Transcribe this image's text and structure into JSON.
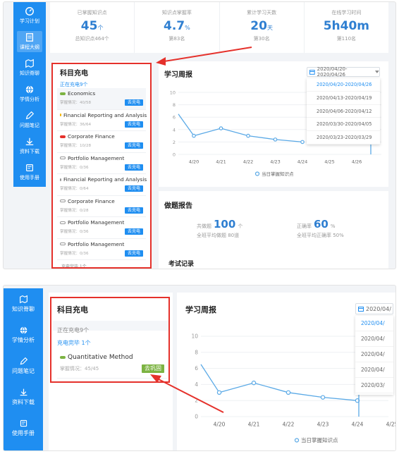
{
  "sidebar_top": {
    "items": [
      {
        "label": "学习计划",
        "icon": "gauge-icon"
      },
      {
        "label": "课程大纲",
        "icon": "book-icon",
        "active": true
      },
      {
        "label": "知识脊聊",
        "icon": "map-icon"
      },
      {
        "label": "学情分析",
        "icon": "globe-icon"
      },
      {
        "label": "问题笔记",
        "icon": "pencil-icon"
      },
      {
        "label": "资料下载",
        "icon": "download-icon"
      },
      {
        "label": "使用手册",
        "icon": "manual-icon"
      }
    ]
  },
  "stats": [
    {
      "label": "已掌握知识点",
      "value": "45",
      "unit": "个",
      "sub": "总知识点464个"
    },
    {
      "label": "知识点掌握率",
      "value": "4.7",
      "unit": "%",
      "sub": "第83名"
    },
    {
      "label": "累计学习天数",
      "value": "20",
      "unit": "天",
      "sub": "第30名"
    },
    {
      "label": "在线学习时间",
      "value": "5h40m",
      "unit": "",
      "sub": "第110名"
    }
  ],
  "course_card": {
    "title": "科目充电",
    "charging_label": "正在充电9个",
    "done_label": "充电完毕 1个",
    "button_label": "去充电",
    "items": [
      {
        "name": "Economics",
        "mastery": "掌握情况：40/58",
        "dot": "#7cb342"
      },
      {
        "name": "Financial Reporting and Analysis",
        "mastery": "掌握情况：36/64",
        "dot": "#f4b400"
      },
      {
        "name": "Corporate Finance",
        "mastery": "掌握情况：10/28",
        "dot": "#e5312b"
      },
      {
        "name": "Portfolio Management",
        "mastery": "掌握情况：0/36",
        "dot": "#ffffff"
      },
      {
        "name": "Financial Reporting and Analysis",
        "mastery": "掌握情况：0/64",
        "dot": "#ffffff"
      },
      {
        "name": "Corporate Finance",
        "mastery": "掌握情况：0/28",
        "dot": "#ffffff"
      },
      {
        "name": "Portfolio Management",
        "mastery": "掌握情况：0/36",
        "dot": "#ffffff"
      },
      {
        "name": "Portfolio Management",
        "mastery": "掌握情况：0/36",
        "dot": "#ffffff"
      }
    ]
  },
  "weekly": {
    "title": "学习周报",
    "range": "2020/04/20-2020/04/26",
    "range_short": "2020/04/",
    "options": [
      "2020/04/20-2020/04/26",
      "2020/04/13-2020/04/19",
      "2020/04/06-2020/04/12",
      "2020/03/30-2020/04/05",
      "2020/03/23-2020/03/29"
    ],
    "options_short": [
      "2020/04/",
      "2020/04/",
      "2020/04/",
      "2020/04/",
      "2020/03/",
      "2020/03/"
    ],
    "legend": "当日掌握知识点"
  },
  "chart_data": {
    "type": "line",
    "categories": [
      "4/20",
      "4/21",
      "4/22",
      "4/23",
      "4/24",
      "4/25",
      "4/26"
    ],
    "series": [
      {
        "name": "当日掌握知识点",
        "values": [
          3,
          4.2,
          3,
          2.4,
          2,
          null,
          null
        ],
        "lead_in": 6.5
      }
    ],
    "yticks": [
      0,
      2,
      4,
      6,
      8,
      10
    ],
    "ylim": [
      0,
      10
    ],
    "color": "#5aa9e6"
  },
  "exam": {
    "title": "做题报告",
    "total_label": "共做题",
    "total_value": "100",
    "total_unit": "个",
    "total_sub": "全班平均做题 80道",
    "accuracy_label": "正确率",
    "accuracy_value": "60",
    "accuracy_unit": "%",
    "accuracy_sub": "全班平均正确率 50%",
    "records_label": "考试记录"
  },
  "sidebar_bottom": {
    "items": [
      {
        "label": "知识脊聊",
        "icon": "map-icon"
      },
      {
        "label": "学情分析",
        "icon": "globe-icon"
      },
      {
        "label": "问题笔记",
        "icon": "pencil-icon"
      },
      {
        "label": "资料下载",
        "icon": "download-icon"
      },
      {
        "label": "使用手册",
        "icon": "manual-icon"
      }
    ]
  },
  "course_card2": {
    "title": "科目充电",
    "charging_label": "正在充电9个",
    "done_label": "充电完毕 1个",
    "item_name": "Quantitative Method",
    "item_mastery": "掌握情况：45/45",
    "item_button": "去巩固",
    "dot": "#7cb342"
  },
  "colors": {
    "accent": "#1f8ef1",
    "highlight": "#e5312b",
    "consolidate": "#7cb342"
  }
}
